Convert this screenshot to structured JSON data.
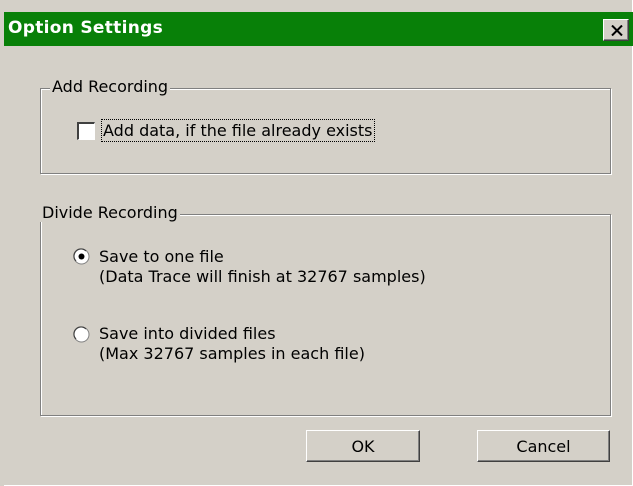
{
  "window": {
    "title": "Option Settings",
    "close_label": "close"
  },
  "add_recording": {
    "legend": "Add Recording",
    "checkbox_label": "Add data, if the file already exists",
    "checked": false
  },
  "divide_recording": {
    "legend": "Divide Recording",
    "options": [
      {
        "line1": "Save to one file",
        "line2": "(Data Trace will finish at 32767 samples)",
        "selected": true
      },
      {
        "line1": "Save into divided files",
        "line2": "(Max 32767 samples in each file)",
        "selected": false
      }
    ]
  },
  "buttons": {
    "ok": "OK",
    "cancel": "Cancel"
  }
}
